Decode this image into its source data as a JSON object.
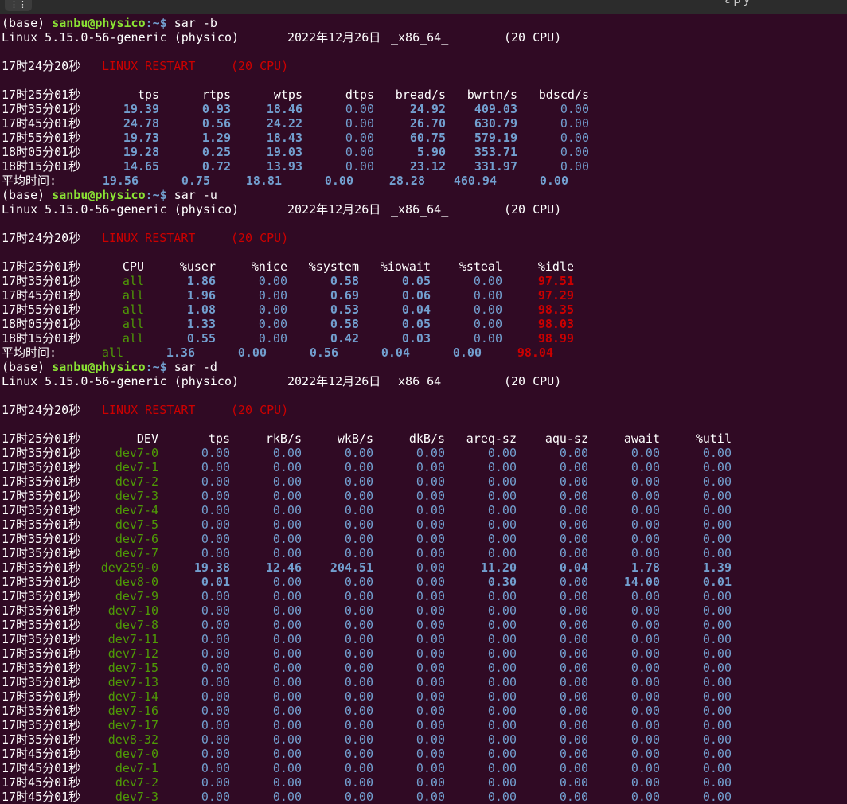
{
  "window": {
    "menu_glyph": "⋮⋮",
    "title_fragment": "~ ε ρ y"
  },
  "prompt": {
    "base": "(base)",
    "user_host": "sanbu@physico",
    "path": ":~$"
  },
  "sysinfo": {
    "kernel": "Linux 5.15.0-56-generic (physico)",
    "date": "2022年12月26日",
    "arch": "_x86_64_",
    "cpus": "(20 CPU)"
  },
  "restart": {
    "time": "17时24分20秒",
    "label": "LINUX RESTART",
    "cpus": "(20 CPU)"
  },
  "avg_label": "平均时间:",
  "sections": [
    {
      "command": "sar -b",
      "header_time": "17时25分01秒",
      "columns": [
        "tps",
        "rtps",
        "wtps",
        "dtps",
        "bread/s",
        "bwrtn/s",
        "bdscd/s"
      ],
      "rows": [
        {
          "time": "17时35分01秒",
          "values": [
            "19.39",
            "0.93",
            "18.46",
            "0.00",
            "24.92",
            "409.03",
            "0.00"
          ]
        },
        {
          "time": "17时45分01秒",
          "values": [
            "24.78",
            "0.56",
            "24.22",
            "0.00",
            "26.70",
            "630.79",
            "0.00"
          ]
        },
        {
          "time": "17时55分01秒",
          "values": [
            "19.73",
            "1.29",
            "18.43",
            "0.00",
            "60.75",
            "579.19",
            "0.00"
          ]
        },
        {
          "time": "18时05分01秒",
          "values": [
            "19.28",
            "0.25",
            "19.03",
            "0.00",
            "5.90",
            "353.71",
            "0.00"
          ]
        },
        {
          "time": "18时15分01秒",
          "values": [
            "14.65",
            "0.72",
            "13.93",
            "0.00",
            "23.12",
            "331.97",
            "0.00"
          ]
        }
      ],
      "average": [
        "19.56",
        "0.75",
        "18.81",
        "0.00",
        "28.28",
        "460.94",
        "0.00"
      ]
    },
    {
      "command": "sar -u",
      "header_time": "17时25分01秒",
      "columns": [
        "CPU",
        "%user",
        "%nice",
        "%system",
        "%iowait",
        "%steal",
        "%idle"
      ],
      "rows": [
        {
          "time": "17时35分01秒",
          "values": [
            "all",
            "1.86",
            "0.00",
            "0.58",
            "0.05",
            "0.00",
            "97.51"
          ]
        },
        {
          "time": "17时45分01秒",
          "values": [
            "all",
            "1.96",
            "0.00",
            "0.69",
            "0.06",
            "0.00",
            "97.29"
          ]
        },
        {
          "time": "17时55分01秒",
          "values": [
            "all",
            "1.08",
            "0.00",
            "0.53",
            "0.04",
            "0.00",
            "98.35"
          ]
        },
        {
          "time": "18时05分01秒",
          "values": [
            "all",
            "1.33",
            "0.00",
            "0.58",
            "0.05",
            "0.00",
            "98.03"
          ]
        },
        {
          "time": "18时15分01秒",
          "values": [
            "all",
            "0.55",
            "0.00",
            "0.42",
            "0.03",
            "0.00",
            "98.99"
          ]
        }
      ],
      "average": [
        "all",
        "1.36",
        "0.00",
        "0.56",
        "0.04",
        "0.00",
        "98.04"
      ]
    },
    {
      "command": "sar -d",
      "header_time": "17时25分01秒",
      "columns": [
        "DEV",
        "tps",
        "rkB/s",
        "wkB/s",
        "dkB/s",
        "areq-sz",
        "aqu-sz",
        "await",
        "%util"
      ],
      "rows": [
        {
          "time": "17时35分01秒",
          "values": [
            "dev7-0",
            "0.00",
            "0.00",
            "0.00",
            "0.00",
            "0.00",
            "0.00",
            "0.00",
            "0.00"
          ]
        },
        {
          "time": "17时35分01秒",
          "values": [
            "dev7-1",
            "0.00",
            "0.00",
            "0.00",
            "0.00",
            "0.00",
            "0.00",
            "0.00",
            "0.00"
          ]
        },
        {
          "time": "17时35分01秒",
          "values": [
            "dev7-2",
            "0.00",
            "0.00",
            "0.00",
            "0.00",
            "0.00",
            "0.00",
            "0.00",
            "0.00"
          ]
        },
        {
          "time": "17时35分01秒",
          "values": [
            "dev7-3",
            "0.00",
            "0.00",
            "0.00",
            "0.00",
            "0.00",
            "0.00",
            "0.00",
            "0.00"
          ]
        },
        {
          "time": "17时35分01秒",
          "values": [
            "dev7-4",
            "0.00",
            "0.00",
            "0.00",
            "0.00",
            "0.00",
            "0.00",
            "0.00",
            "0.00"
          ]
        },
        {
          "time": "17时35分01秒",
          "values": [
            "dev7-5",
            "0.00",
            "0.00",
            "0.00",
            "0.00",
            "0.00",
            "0.00",
            "0.00",
            "0.00"
          ]
        },
        {
          "time": "17时35分01秒",
          "values": [
            "dev7-6",
            "0.00",
            "0.00",
            "0.00",
            "0.00",
            "0.00",
            "0.00",
            "0.00",
            "0.00"
          ]
        },
        {
          "time": "17时35分01秒",
          "values": [
            "dev7-7",
            "0.00",
            "0.00",
            "0.00",
            "0.00",
            "0.00",
            "0.00",
            "0.00",
            "0.00"
          ]
        },
        {
          "time": "17时35分01秒",
          "values": [
            "dev259-0",
            "19.38",
            "12.46",
            "204.51",
            "0.00",
            "11.20",
            "0.04",
            "1.78",
            "1.39"
          ]
        },
        {
          "time": "17时35分01秒",
          "values": [
            "dev8-0",
            "0.01",
            "0.00",
            "0.00",
            "0.00",
            "0.30",
            "0.00",
            "14.00",
            "0.01"
          ]
        },
        {
          "time": "17时35分01秒",
          "values": [
            "dev7-9",
            "0.00",
            "0.00",
            "0.00",
            "0.00",
            "0.00",
            "0.00",
            "0.00",
            "0.00"
          ]
        },
        {
          "time": "17时35分01秒",
          "values": [
            "dev7-10",
            "0.00",
            "0.00",
            "0.00",
            "0.00",
            "0.00",
            "0.00",
            "0.00",
            "0.00"
          ]
        },
        {
          "time": "17时35分01秒",
          "values": [
            "dev7-8",
            "0.00",
            "0.00",
            "0.00",
            "0.00",
            "0.00",
            "0.00",
            "0.00",
            "0.00"
          ]
        },
        {
          "time": "17时35分01秒",
          "values": [
            "dev7-11",
            "0.00",
            "0.00",
            "0.00",
            "0.00",
            "0.00",
            "0.00",
            "0.00",
            "0.00"
          ]
        },
        {
          "time": "17时35分01秒",
          "values": [
            "dev7-12",
            "0.00",
            "0.00",
            "0.00",
            "0.00",
            "0.00",
            "0.00",
            "0.00",
            "0.00"
          ]
        },
        {
          "time": "17时35分01秒",
          "values": [
            "dev7-15",
            "0.00",
            "0.00",
            "0.00",
            "0.00",
            "0.00",
            "0.00",
            "0.00",
            "0.00"
          ]
        },
        {
          "time": "17时35分01秒",
          "values": [
            "dev7-13",
            "0.00",
            "0.00",
            "0.00",
            "0.00",
            "0.00",
            "0.00",
            "0.00",
            "0.00"
          ]
        },
        {
          "time": "17时35分01秒",
          "values": [
            "dev7-14",
            "0.00",
            "0.00",
            "0.00",
            "0.00",
            "0.00",
            "0.00",
            "0.00",
            "0.00"
          ]
        },
        {
          "time": "17时35分01秒",
          "values": [
            "dev7-16",
            "0.00",
            "0.00",
            "0.00",
            "0.00",
            "0.00",
            "0.00",
            "0.00",
            "0.00"
          ]
        },
        {
          "time": "17时35分01秒",
          "values": [
            "dev7-17",
            "0.00",
            "0.00",
            "0.00",
            "0.00",
            "0.00",
            "0.00",
            "0.00",
            "0.00"
          ]
        },
        {
          "time": "17时35分01秒",
          "values": [
            "dev8-32",
            "0.00",
            "0.00",
            "0.00",
            "0.00",
            "0.00",
            "0.00",
            "0.00",
            "0.00"
          ]
        },
        {
          "time": "17时45分01秒",
          "values": [
            "dev7-0",
            "0.00",
            "0.00",
            "0.00",
            "0.00",
            "0.00",
            "0.00",
            "0.00",
            "0.00"
          ]
        },
        {
          "time": "17时45分01秒",
          "values": [
            "dev7-1",
            "0.00",
            "0.00",
            "0.00",
            "0.00",
            "0.00",
            "0.00",
            "0.00",
            "0.00"
          ]
        },
        {
          "time": "17时45分01秒",
          "values": [
            "dev7-2",
            "0.00",
            "0.00",
            "0.00",
            "0.00",
            "0.00",
            "0.00",
            "0.00",
            "0.00"
          ]
        },
        {
          "time": "17时45分01秒",
          "values": [
            "dev7-3",
            "0.00",
            "0.00",
            "0.00",
            "0.00",
            "0.00",
            "0.00",
            "0.00",
            "0.00"
          ]
        }
      ]
    }
  ],
  "colors": {
    "background": "#300a24",
    "text": "#ffffff",
    "prompt_user": "#8ae234",
    "device_name": "#4e9a06",
    "numeric": "#729fcf",
    "idle_high": "#cc0000",
    "restart": "#cc0000"
  }
}
